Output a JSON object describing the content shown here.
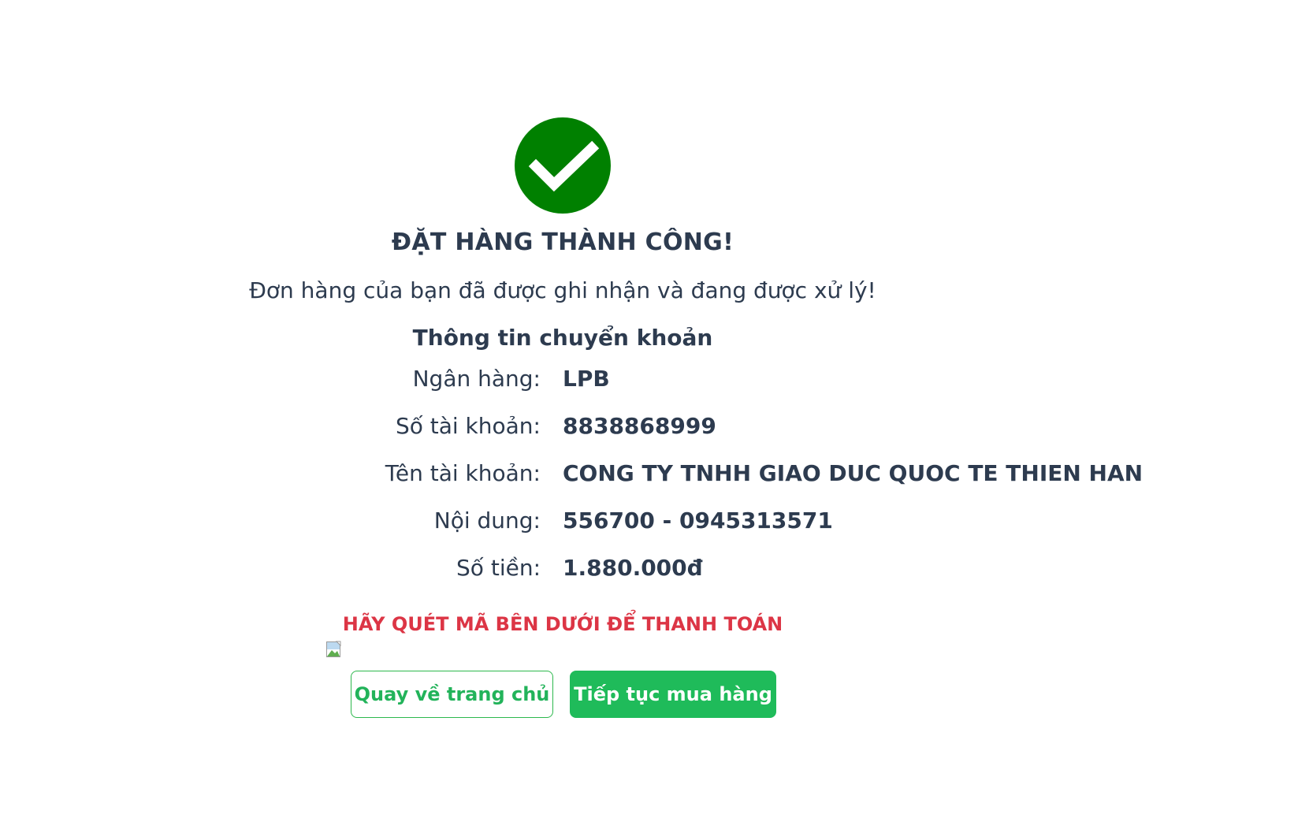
{
  "status": {
    "title": "ĐẶT HÀNG THÀNH CÔNG!",
    "message": "Đơn hàng của bạn đã được ghi nhận và đang được xử lý!",
    "icon": "check-circle-icon",
    "icon_color": "#008000"
  },
  "transfer": {
    "heading": "Thông tin chuyển khoản",
    "rows": [
      {
        "label": "Ngân hàng:",
        "value": "LPB"
      },
      {
        "label": "Số tài khoản:",
        "value": "8838868999"
      },
      {
        "label": "Tên tài khoản:",
        "value": "CONG TY TNHH GIAO DUC QUOC TE THIEN HAN"
      },
      {
        "label": "Nội dung:",
        "value": "556700 - 0945313571"
      },
      {
        "label": "Số tiền:",
        "value": "1.880.000đ"
      }
    ]
  },
  "payment": {
    "scan_note": "HÃY QUÉT MÃ BÊN DƯỚI ĐỂ THANH TOÁN",
    "scan_note_color": "#dc3545",
    "qr_image_icon": "broken-image-icon"
  },
  "actions": {
    "home_label": "Quay về trang chủ",
    "continue_label": "Tiếp tục mua hàng",
    "accent_color": "#1fbb5a"
  }
}
